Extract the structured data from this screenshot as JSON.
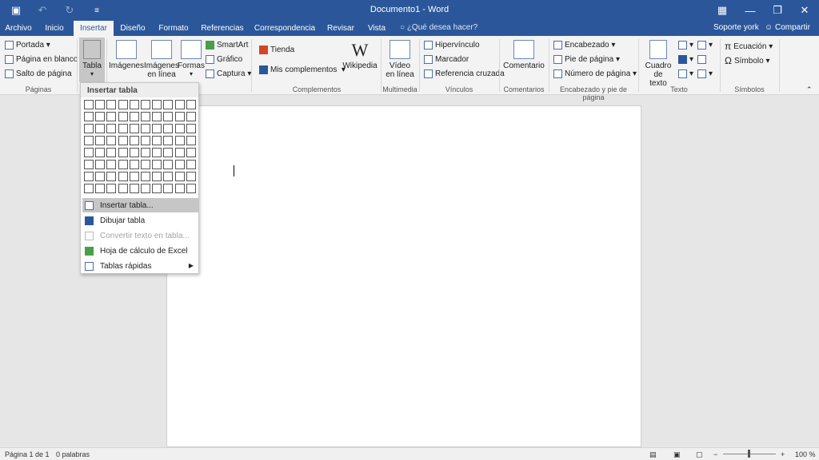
{
  "title_bar": {
    "title": "Documento1 - Word",
    "save_icon": "save-icon",
    "undo_icon": "undo-icon",
    "redo_icon": "redo-icon",
    "customize_icon": "customize-icon"
  },
  "tabs": {
    "items": [
      "Archivo",
      "Inicio",
      "Insertar",
      "Diseño",
      "Formato",
      "Referencias",
      "Correspondencia",
      "Revisar",
      "Vista"
    ],
    "active": "Insertar",
    "tell_me": "¿Qué desea hacer?",
    "user": "Soporte york",
    "share": "Compartir"
  },
  "ribbon": {
    "paginas": {
      "portada": "Portada",
      "pagina_en_blanco": "Página en blanco",
      "salto": "Salto de página",
      "label": "Páginas"
    },
    "tablas": {
      "tabla": "Tabla"
    },
    "ilustraciones": {
      "imagenes": "Imágenes",
      "imagenes_en_linea_1": "Imágenes",
      "imagenes_en_linea_2": "en línea",
      "formas": "Formas",
      "smartart": "SmartArt",
      "grafico": "Gráfico",
      "captura": "Captura"
    },
    "complementos": {
      "tienda": "Tienda",
      "mis_complementos": "Mis complementos",
      "wikipedia": "Wikipedia",
      "label": "Complementos"
    },
    "multimedia": {
      "video_1": "Vídeo",
      "video_2": "en línea",
      "label": "Multimedia"
    },
    "vinculos": {
      "hipervinculo": "Hipervínculo",
      "marcador": "Marcador",
      "referencia": "Referencia cruzada",
      "label": "Vínculos"
    },
    "comentarios": {
      "comentario": "Comentario",
      "label": "Comentarios"
    },
    "encabezado": {
      "encabezado": "Encabezado",
      "pie": "Pie de página",
      "numero": "Número de página",
      "label": "Encabezado y pie de página"
    },
    "texto": {
      "cuadro_1": "Cuadro de",
      "cuadro_2": "texto",
      "label": "Texto"
    },
    "simbolos": {
      "ecuacion": "Ecuación",
      "simbolo": "Símbolo",
      "label": "Símbolos"
    }
  },
  "dropdown": {
    "header": "Insertar tabla",
    "grid": {
      "cols": 10,
      "rows": 8
    },
    "items": [
      "Insertar tabla...",
      "Dibujar tabla",
      "Convertir texto en tabla...",
      "Hoja de cálculo de Excel",
      "Tablas rápidas"
    ]
  },
  "status": {
    "page": "Página 1 de 1",
    "words": "0 palabras",
    "zoom": "100 %"
  }
}
